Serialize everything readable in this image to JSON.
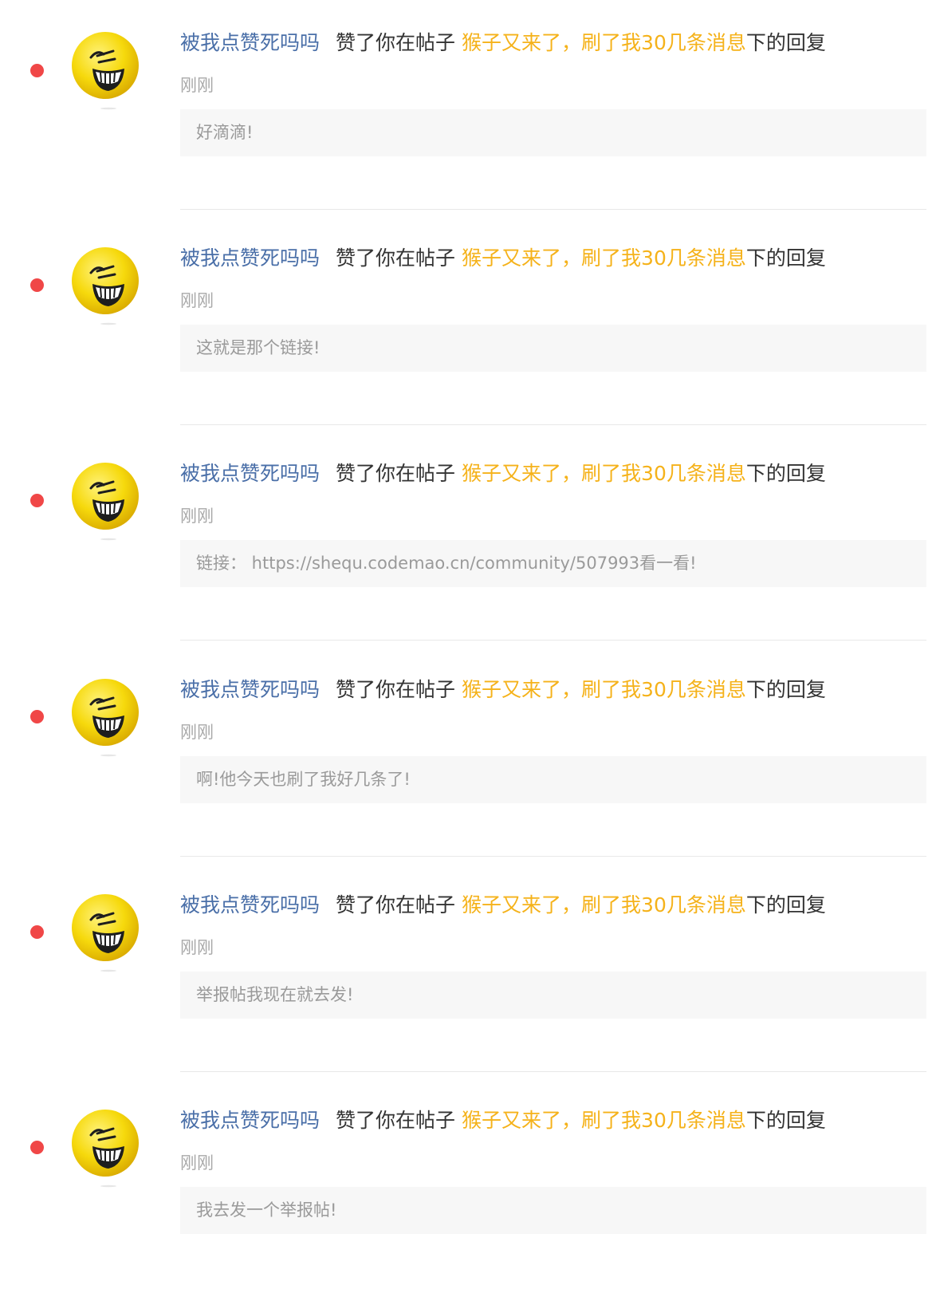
{
  "colors": {
    "unread_dot": "#f04747",
    "username": "#4a6fa8",
    "post_title": "#f5b21a",
    "text": "#333333",
    "muted": "#a8a8a8",
    "quote_bg": "#f7f7f7"
  },
  "notifications": [
    {
      "username": "被我点赞死吗吗",
      "verb": "赞了你在帖子",
      "post_title": "猴子又来了，刷了我30几条消息",
      "suffix": "下的回复",
      "time": "刚刚",
      "reply": "好滴滴!",
      "unread": true,
      "avatar_icon": "laughing-emoji-icon"
    },
    {
      "username": "被我点赞死吗吗",
      "verb": "赞了你在帖子",
      "post_title": "猴子又来了，刷了我30几条消息",
      "suffix": "下的回复",
      "time": "刚刚",
      "reply": "这就是那个链接!",
      "unread": true,
      "avatar_icon": "laughing-emoji-icon"
    },
    {
      "username": "被我点赞死吗吗",
      "verb": "赞了你在帖子",
      "post_title": "猴子又来了，刷了我30几条消息",
      "suffix": "下的回复",
      "time": "刚刚",
      "reply": "链接： https://shequ.codemao.cn/community/507993看一看!",
      "unread": true,
      "avatar_icon": "laughing-emoji-icon"
    },
    {
      "username": "被我点赞死吗吗",
      "verb": "赞了你在帖子",
      "post_title": "猴子又来了，刷了我30几条消息",
      "suffix": "下的回复",
      "time": "刚刚",
      "reply": "啊!他今天也刷了我好几条了!",
      "unread": true,
      "avatar_icon": "laughing-emoji-icon"
    },
    {
      "username": "被我点赞死吗吗",
      "verb": "赞了你在帖子",
      "post_title": "猴子又来了，刷了我30几条消息",
      "suffix": "下的回复",
      "time": "刚刚",
      "reply": "举报帖我现在就去发!",
      "unread": true,
      "avatar_icon": "laughing-emoji-icon"
    },
    {
      "username": "被我点赞死吗吗",
      "verb": "赞了你在帖子",
      "post_title": "猴子又来了，刷了我30几条消息",
      "suffix": "下的回复",
      "time": "刚刚",
      "reply": "我去发一个举报帖!",
      "unread": true,
      "avatar_icon": "laughing-emoji-icon"
    }
  ]
}
